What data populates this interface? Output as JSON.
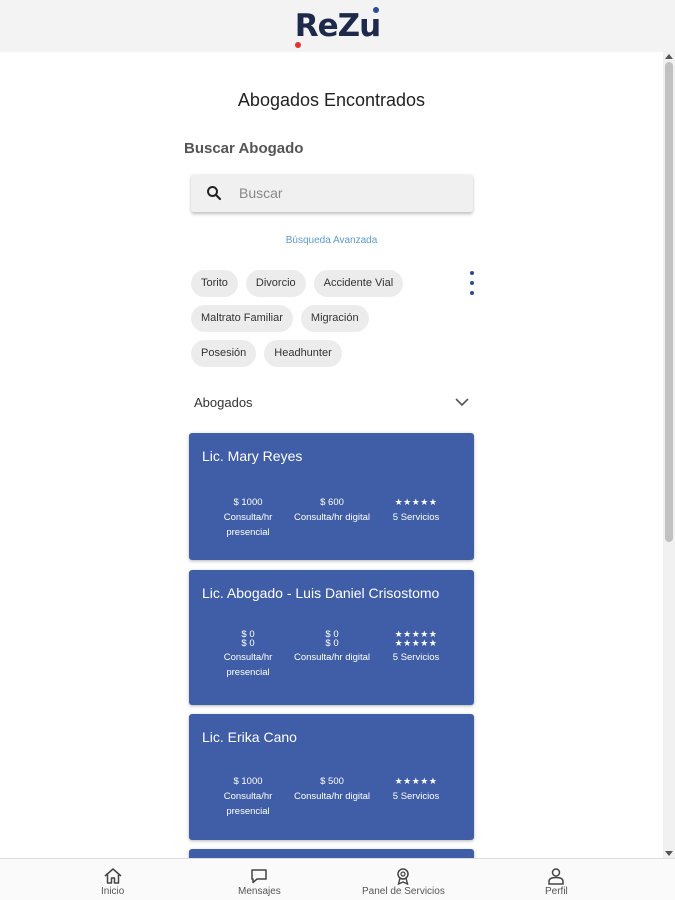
{
  "app": {
    "logo": "ReZu"
  },
  "page": {
    "title": "Abogados Encontrados",
    "search_label": "Buscar Abogado",
    "advanced_search": "Búsqueda Avanzada"
  },
  "search": {
    "placeholder": "Buscar",
    "value": ""
  },
  "chips": [
    [
      "Torito",
      "Divorcio",
      "Accidente Vial"
    ],
    [
      "Maltrato Familiar",
      "Migración"
    ],
    [
      "Posesión",
      "Headhunter"
    ]
  ],
  "accordion": {
    "label": "Abogados"
  },
  "lawyers": [
    {
      "name": "Lic. Mary Reyes",
      "price_presencial": "$ 1000",
      "price_digital": "$ 600",
      "stars": "★★★★★",
      "stars2": "",
      "presencial_label": "Consulta/hr presencial",
      "digital_label": "Consulta/hr digital",
      "services": "5 Servicios"
    },
    {
      "name": "Lic. Abogado - Luis Daniel Crisostomo",
      "price_presencial": "$ 0",
      "price_presencial2": "$ 0",
      "price_digital": "$ 0",
      "price_digital2": "$ 0",
      "stars": "★★★★★",
      "stars2": "★★★★★",
      "presencial_label": "Consulta/hr presencial",
      "digital_label": "Consulta/hr digital",
      "services": "5 Servicios"
    },
    {
      "name": "Lic. Erika Cano",
      "price_presencial": "$ 1000",
      "price_digital": "$ 500",
      "stars": "★★★★★",
      "stars2": "",
      "presencial_label": "Consulta/hr presencial",
      "digital_label": "Consulta/hr digital",
      "services": "5 Servicios"
    }
  ],
  "nav": {
    "home": "Inicio",
    "messages": "Mensajes",
    "services": "Panel de Servicios",
    "profile": "Perfil"
  },
  "colors": {
    "card": "#3f5ea7",
    "link": "#5b9bd5",
    "logo_dark": "#1e2a4a",
    "logo_red": "#e8312c",
    "logo_blue": "#2d4a9a"
  }
}
